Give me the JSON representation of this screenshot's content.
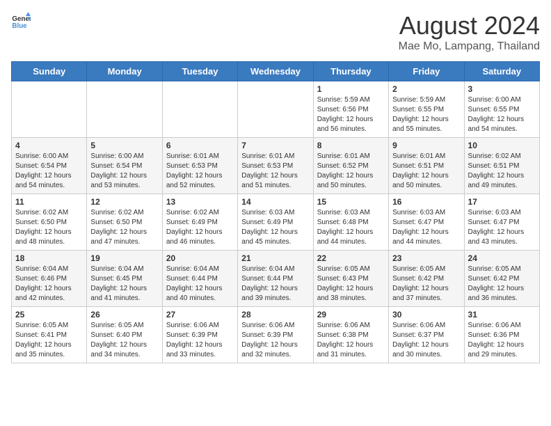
{
  "logo": {
    "text_general": "General",
    "text_blue": "Blue"
  },
  "title": "August 2024",
  "subtitle": "Mae Mo, Lampang, Thailand",
  "days_of_week": [
    "Sunday",
    "Monday",
    "Tuesday",
    "Wednesday",
    "Thursday",
    "Friday",
    "Saturday"
  ],
  "weeks": [
    [
      {
        "day": "",
        "content": ""
      },
      {
        "day": "",
        "content": ""
      },
      {
        "day": "",
        "content": ""
      },
      {
        "day": "",
        "content": ""
      },
      {
        "day": "1",
        "content": "Sunrise: 5:59 AM\nSunset: 6:56 PM\nDaylight: 12 hours\nand 56 minutes."
      },
      {
        "day": "2",
        "content": "Sunrise: 5:59 AM\nSunset: 6:55 PM\nDaylight: 12 hours\nand 55 minutes."
      },
      {
        "day": "3",
        "content": "Sunrise: 6:00 AM\nSunset: 6:55 PM\nDaylight: 12 hours\nand 54 minutes."
      }
    ],
    [
      {
        "day": "4",
        "content": "Sunrise: 6:00 AM\nSunset: 6:54 PM\nDaylight: 12 hours\nand 54 minutes."
      },
      {
        "day": "5",
        "content": "Sunrise: 6:00 AM\nSunset: 6:54 PM\nDaylight: 12 hours\nand 53 minutes."
      },
      {
        "day": "6",
        "content": "Sunrise: 6:01 AM\nSunset: 6:53 PM\nDaylight: 12 hours\nand 52 minutes."
      },
      {
        "day": "7",
        "content": "Sunrise: 6:01 AM\nSunset: 6:53 PM\nDaylight: 12 hours\nand 51 minutes."
      },
      {
        "day": "8",
        "content": "Sunrise: 6:01 AM\nSunset: 6:52 PM\nDaylight: 12 hours\nand 50 minutes."
      },
      {
        "day": "9",
        "content": "Sunrise: 6:01 AM\nSunset: 6:51 PM\nDaylight: 12 hours\nand 50 minutes."
      },
      {
        "day": "10",
        "content": "Sunrise: 6:02 AM\nSunset: 6:51 PM\nDaylight: 12 hours\nand 49 minutes."
      }
    ],
    [
      {
        "day": "11",
        "content": "Sunrise: 6:02 AM\nSunset: 6:50 PM\nDaylight: 12 hours\nand 48 minutes."
      },
      {
        "day": "12",
        "content": "Sunrise: 6:02 AM\nSunset: 6:50 PM\nDaylight: 12 hours\nand 47 minutes."
      },
      {
        "day": "13",
        "content": "Sunrise: 6:02 AM\nSunset: 6:49 PM\nDaylight: 12 hours\nand 46 minutes."
      },
      {
        "day": "14",
        "content": "Sunrise: 6:03 AM\nSunset: 6:49 PM\nDaylight: 12 hours\nand 45 minutes."
      },
      {
        "day": "15",
        "content": "Sunrise: 6:03 AM\nSunset: 6:48 PM\nDaylight: 12 hours\nand 44 minutes."
      },
      {
        "day": "16",
        "content": "Sunrise: 6:03 AM\nSunset: 6:47 PM\nDaylight: 12 hours\nand 44 minutes."
      },
      {
        "day": "17",
        "content": "Sunrise: 6:03 AM\nSunset: 6:47 PM\nDaylight: 12 hours\nand 43 minutes."
      }
    ],
    [
      {
        "day": "18",
        "content": "Sunrise: 6:04 AM\nSunset: 6:46 PM\nDaylight: 12 hours\nand 42 minutes."
      },
      {
        "day": "19",
        "content": "Sunrise: 6:04 AM\nSunset: 6:45 PM\nDaylight: 12 hours\nand 41 minutes."
      },
      {
        "day": "20",
        "content": "Sunrise: 6:04 AM\nSunset: 6:44 PM\nDaylight: 12 hours\nand 40 minutes."
      },
      {
        "day": "21",
        "content": "Sunrise: 6:04 AM\nSunset: 6:44 PM\nDaylight: 12 hours\nand 39 minutes."
      },
      {
        "day": "22",
        "content": "Sunrise: 6:05 AM\nSunset: 6:43 PM\nDaylight: 12 hours\nand 38 minutes."
      },
      {
        "day": "23",
        "content": "Sunrise: 6:05 AM\nSunset: 6:42 PM\nDaylight: 12 hours\nand 37 minutes."
      },
      {
        "day": "24",
        "content": "Sunrise: 6:05 AM\nSunset: 6:42 PM\nDaylight: 12 hours\nand 36 minutes."
      }
    ],
    [
      {
        "day": "25",
        "content": "Sunrise: 6:05 AM\nSunset: 6:41 PM\nDaylight: 12 hours\nand 35 minutes."
      },
      {
        "day": "26",
        "content": "Sunrise: 6:05 AM\nSunset: 6:40 PM\nDaylight: 12 hours\nand 34 minutes."
      },
      {
        "day": "27",
        "content": "Sunrise: 6:06 AM\nSunset: 6:39 PM\nDaylight: 12 hours\nand 33 minutes."
      },
      {
        "day": "28",
        "content": "Sunrise: 6:06 AM\nSunset: 6:39 PM\nDaylight: 12 hours\nand 32 minutes."
      },
      {
        "day": "29",
        "content": "Sunrise: 6:06 AM\nSunset: 6:38 PM\nDaylight: 12 hours\nand 31 minutes."
      },
      {
        "day": "30",
        "content": "Sunrise: 6:06 AM\nSunset: 6:37 PM\nDaylight: 12 hours\nand 30 minutes."
      },
      {
        "day": "31",
        "content": "Sunrise: 6:06 AM\nSunset: 6:36 PM\nDaylight: 12 hours\nand 29 minutes."
      }
    ]
  ]
}
